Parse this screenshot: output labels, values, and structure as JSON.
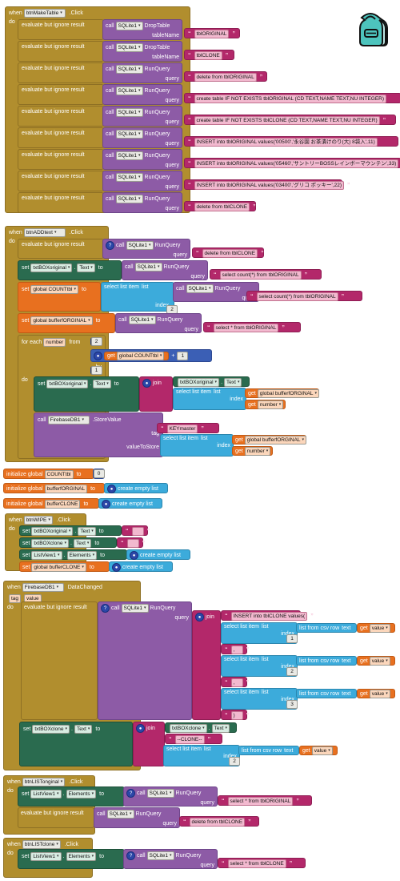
{
  "workspace": {
    "backpack_icon": "backpack-icon",
    "background": "#ffffff"
  },
  "colors": {
    "event": "#b18e2e",
    "control": "#b18e2e",
    "component_call": "#8d5ba6",
    "text": "#b3286a",
    "setter": "#2a6b4f",
    "variable": "#e8701f",
    "list": "#3cabdb",
    "math": "#3b5fb5",
    "backpack": "#4dc4bd"
  },
  "common": {
    "when": "when",
    "do": "do",
    "call": "call",
    "set": "set",
    "to": "to",
    "get": "get",
    "click": ".Click",
    "evaluate": "evaluate but ignore result",
    "query_label": "query",
    "tablename_label": "tableName",
    "index_label": "index",
    "list_label": "list",
    "text_label": "text",
    "tag_label": "tag",
    "value_to_store_label": "valueToStore",
    "select_list_item": "select list item",
    "list_from_csv_row": "list from csv row",
    "create_empty_list": "create empty list",
    "join": "join",
    "for_each": "for each",
    "from": "from",
    "to_word": "to",
    "by": "by",
    "initialize_global": "initialize global",
    "dot": ".",
    "sqlite": "SQLite1",
    "run_query": "RunQuery",
    "drop_table": "DropTable",
    "store_value": ".StoreValue",
    "data_changed": "DataChanged",
    "firebase": "FirebaseDB1",
    "plus": "+"
  },
  "blocks": {
    "make_table": {
      "event_name": "btnMakeTable",
      "rows": [
        {
          "method": "DropTable",
          "arg_label": "tableName",
          "value": "tblORIGINAL"
        },
        {
          "method": "DropTable",
          "arg_label": "tableName",
          "value": "tblCLONE"
        },
        {
          "method": "RunQuery",
          "arg_label": "query",
          "value": "delete from tblORIGINAL"
        },
        {
          "method": "RunQuery",
          "arg_label": "query",
          "value": "create table IF NOT EXISTS tblORIGINAL (CD TEXT,NAME TEXT,NU INTEGER)"
        },
        {
          "method": "RunQuery",
          "arg_label": "query",
          "value": "create table IF NOT EXISTS tblCLONE (CD TEXT,NAME TEXT,NU INTEGER)"
        },
        {
          "method": "RunQuery",
          "arg_label": "query",
          "value": "INSERT into tblORIGINAL values('00500','永谷園 お茶漬けのり(大) 8袋入',11)"
        },
        {
          "method": "RunQuery",
          "arg_label": "query",
          "value": "INSERT into tblORIGINAL values('05460','サントリーBOSSレインボーマウンテン',33)"
        },
        {
          "method": "RunQuery",
          "arg_label": "query",
          "value": "INSERT into tblORIGINAL values('03400','グリコ ポッキー',22)"
        },
        {
          "method": "RunQuery",
          "arg_label": "query",
          "value": "delete from tblCLONE"
        }
      ]
    },
    "add_text": {
      "event_name": "btnADDtext",
      "r1": {
        "label": "evaluate but ignore result",
        "method": "RunQuery",
        "query": "delete from tblCLONE"
      },
      "r2": {
        "component": "txtBOXoriginal",
        "property": "Text",
        "method": "RunQuery",
        "query": "select count(*) from tblORIGINAL"
      },
      "r3": {
        "global": "global COUNTtbl",
        "method": "RunQuery",
        "query": "select count(*) from tblORIGINAL",
        "index": "2"
      },
      "r4": {
        "global": "global bufferfORGINAL",
        "method": "RunQuery",
        "query": "select * from tblORIGINAL"
      },
      "loop": {
        "var": "number",
        "from": "2",
        "to_get": "global COUNTtbl",
        "to_add": "1",
        "by": "1"
      },
      "body1": {
        "component": "txtBOXoriginal",
        "property": "Text",
        "join_a_component": "txtBOXoriginal",
        "join_a_property": "Text",
        "list_get": "global bufferfORGINAL",
        "index_get": "number"
      },
      "body2": {
        "component": "FirebaseDB1",
        "method": ".StoreValue",
        "tag": "KEYmaster",
        "list_get": "global bufferfORGINAL",
        "index_get": "number"
      }
    },
    "globals": [
      {
        "name": "COUNTtbl",
        "value": "0",
        "value_kind": "number"
      },
      {
        "name": "bufferfORGINAL",
        "value": "create empty list",
        "value_kind": "list"
      },
      {
        "name": "bufferCLONE",
        "value": "create empty list",
        "value_kind": "list"
      }
    ],
    "wipe": {
      "event_name": "btnWIPE",
      "rows": [
        {
          "kind": "component",
          "component": "txtBOXoriginal",
          "property": "Text",
          "value": "",
          "value_kind": "text"
        },
        {
          "kind": "component",
          "component": "txtBOXclone",
          "property": "Text",
          "value": "",
          "value_kind": "text"
        },
        {
          "kind": "component",
          "component": "ListView1",
          "property": "Elements",
          "value": "create empty list",
          "value_kind": "list"
        },
        {
          "kind": "global",
          "component": "global bufferCLONE",
          "property": "",
          "value": "create empty list",
          "value_kind": "list"
        }
      ]
    },
    "data_changed": {
      "event_component": "FirebaseDB1",
      "event_name": "DataChanged",
      "params": [
        "tag",
        "value"
      ],
      "query_parts": [
        {
          "kind": "text",
          "value": "INSERT into tblCLONE values("
        },
        {
          "kind": "listitem",
          "index": "1",
          "get": "value"
        },
        {
          "kind": "text",
          "value": ","
        },
        {
          "kind": "listitem",
          "index": "2",
          "get": "value"
        },
        {
          "kind": "text",
          "value": ","
        },
        {
          "kind": "listitem",
          "index": "3",
          "get": "value"
        },
        {
          "kind": "text",
          "value": ")"
        }
      ],
      "setter": {
        "component": "txtBOXclone",
        "property": "Text",
        "join_component": "txtBOXclone",
        "join_property": "Text",
        "literal": "--CLONE--",
        "index": "2",
        "get": "value"
      }
    },
    "list_original": {
      "event_name": "btnLISTonginal",
      "setter": {
        "component": "ListView1",
        "property": "Elements",
        "method": "RunQuery",
        "query": "select * from tblORIGINAL"
      },
      "evaluate": {
        "label": "evaluate but ignore result",
        "method": "RunQuery",
        "query": "delete from tblCLONE"
      }
    },
    "list_clone": {
      "event_name": "btnLISTclone",
      "setter": {
        "component": "ListView1",
        "property": "Elements",
        "method": "RunQuery",
        "query": "select * from tblCLONE"
      }
    }
  }
}
